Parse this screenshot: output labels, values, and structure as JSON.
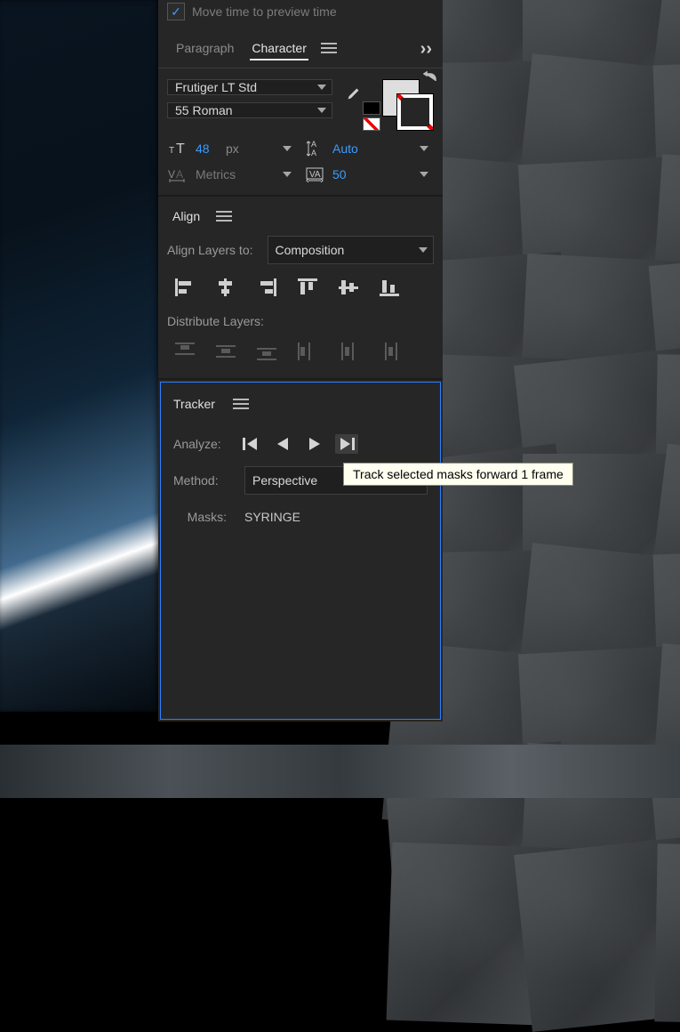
{
  "top_checkbox": {
    "label": "Move time to preview time",
    "checked": true
  },
  "tabs": {
    "paragraph": "Paragraph",
    "character": "Character"
  },
  "character": {
    "font_family": "Frutiger LT Std",
    "font_style": "55 Roman",
    "font_size": {
      "value": "48",
      "unit": "px"
    },
    "leading": "Auto",
    "kerning": "Metrics",
    "tracking": "50"
  },
  "align": {
    "title": "Align",
    "to_label": "Align Layers to:",
    "to_value": "Composition",
    "distribute_label": "Distribute Layers:"
  },
  "tracker": {
    "title": "Tracker",
    "analyze_label": "Analyze:",
    "method_label": "Method:",
    "method_value": "Perspective",
    "masks_label": "Masks:",
    "masks_value": "SYRINGE"
  },
  "tooltip": "Track selected masks forward 1 frame"
}
